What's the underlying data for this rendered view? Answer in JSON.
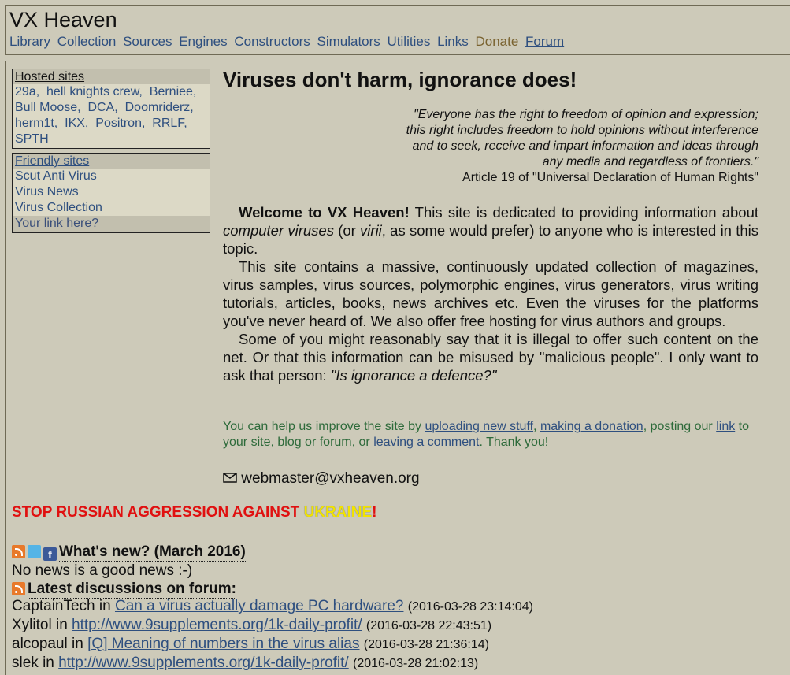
{
  "header": {
    "title": "VX Heaven",
    "nav": [
      "Library",
      "Collection",
      "Sources",
      "Engines",
      "Constructors",
      "Simulators",
      "Utilities",
      "Links"
    ],
    "donate": "Donate",
    "forum": "Forum"
  },
  "hosted": {
    "title": "Hosted sites",
    "items": [
      "29a,",
      "hell knights crew,",
      "Berniee,",
      "Bull Moose,",
      "DCA,",
      "Doomriderz,",
      "herm1t,",
      "IKX,",
      "Positron,",
      "RRLF,",
      "SPTH"
    ]
  },
  "friendly": {
    "title": "Friendly sites",
    "items": [
      "Scut Anti Virus",
      "Virus News",
      "Virus Collection"
    ],
    "your_link": "Your link here?"
  },
  "main": {
    "headline": "Viruses don't harm, ignorance does!",
    "quote_lines": [
      "\"Everyone has the right to freedom of opinion and expression;",
      "this right includes freedom to hold opinions without interference",
      "and to seek, receive and impart information and ideas through",
      "any media and regardless of frontiers.\""
    ],
    "quote_source": "Article 19 of \"Universal Declaration of Human Rights\"",
    "welcome_bold": "Welcome to",
    "welcome_vx": "VX",
    "welcome_heaven": "Heaven!",
    "p1_a": " This site is dedicated to providing information about ",
    "p1_b": "computer viruses",
    "p1_c": " (or ",
    "p1_d": "virii",
    "p1_e": ", as some would prefer) to anyone who is interested in this topic.",
    "p2": "This site contains a massive, continuously updated collection of magazines, virus samples, virus sources, polymorphic engines, virus generators, virus writing tutorials, articles, books, news archives etc. Even the viruses for the platforms you've never heard of. We also offer free hosting for virus authors and groups.",
    "p3_a": "Some of you might reasonably say that it is illegal to offer such content on the net. Or that this information can be misused by \"malicious people\". I only want to ask that person: ",
    "p3_b": "\"Is ignorance a defence?\"",
    "help_a": "You can help us improve the site by ",
    "help_link1": "uploading new stuff",
    "help_b": ", ",
    "help_link2": "making a donation",
    "help_c": ", posting our ",
    "help_link3": "link",
    "help_d": " to your site, blog or forum, or ",
    "help_link4": "leaving a comment",
    "help_e": ". Thank you!",
    "email": "webmaster@vxheaven.org"
  },
  "banner": {
    "text": "STOP RUSSIAN AGGRESSION AGAINST ",
    "ukr_a": "UKR",
    "ukr_b": "AINE",
    "end": "!"
  },
  "news": {
    "title": "What's new? (March 2016)",
    "body": "No news is a good news :-)",
    "forum_title": "Latest discussions on forum:"
  },
  "forum_posts": [
    {
      "user": "CaptainTech",
      "in": " in ",
      "topic": "Can a virus actually damage PC hardware?",
      "date": "(2016-03-28 23:14:04)"
    },
    {
      "user": "Xylitol",
      "in": " in ",
      "topic": "http://www.9supplements.org/1k-daily-profit/",
      "date": "(2016-03-28 22:43:51)"
    },
    {
      "user": "alcopaul",
      "in": " in ",
      "topic": "[Q] Meaning of numbers in the virus alias",
      "date": "(2016-03-28 21:36:14)"
    },
    {
      "user": "slek",
      "in": " in ",
      "topic": "http://www.9supplements.org/1k-daily-profit/",
      "date": "(2016-03-28 21:02:13)"
    }
  ],
  "colors": {
    "background": "#cdcab9",
    "link": "#2e4f7f",
    "help_text": "#2d6a3a",
    "banner": "#e01010"
  },
  "icons": [
    "rss-icon",
    "twitter-icon",
    "facebook-icon",
    "mail-icon"
  ]
}
